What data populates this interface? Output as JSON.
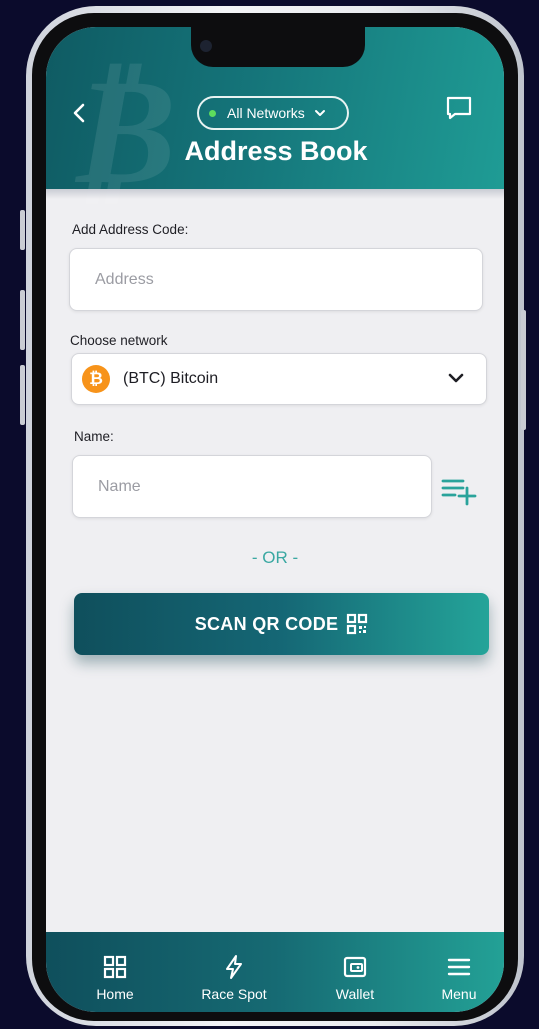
{
  "header": {
    "network_selector": "All Networks",
    "title": "Address Book"
  },
  "form": {
    "address_label": "Add Address Code:",
    "address_placeholder": "Address",
    "network_label": "Choose network",
    "network_value": "(BTC) Bitcoin",
    "network_icon": "bitcoin-icon",
    "name_label": "Name:",
    "name_placeholder": "Name"
  },
  "divider_text": "- OR -",
  "scan_button": "SCAN QR CODE",
  "bottom_nav": {
    "home": "Home",
    "race_spot": "Race Spot",
    "wallet": "Wallet",
    "menu": "Menu"
  },
  "colors": {
    "brand_teal": "#15757a",
    "accent": "#23a196",
    "online_dot": "#5ddc5d",
    "bitcoin": "#f7931a"
  }
}
